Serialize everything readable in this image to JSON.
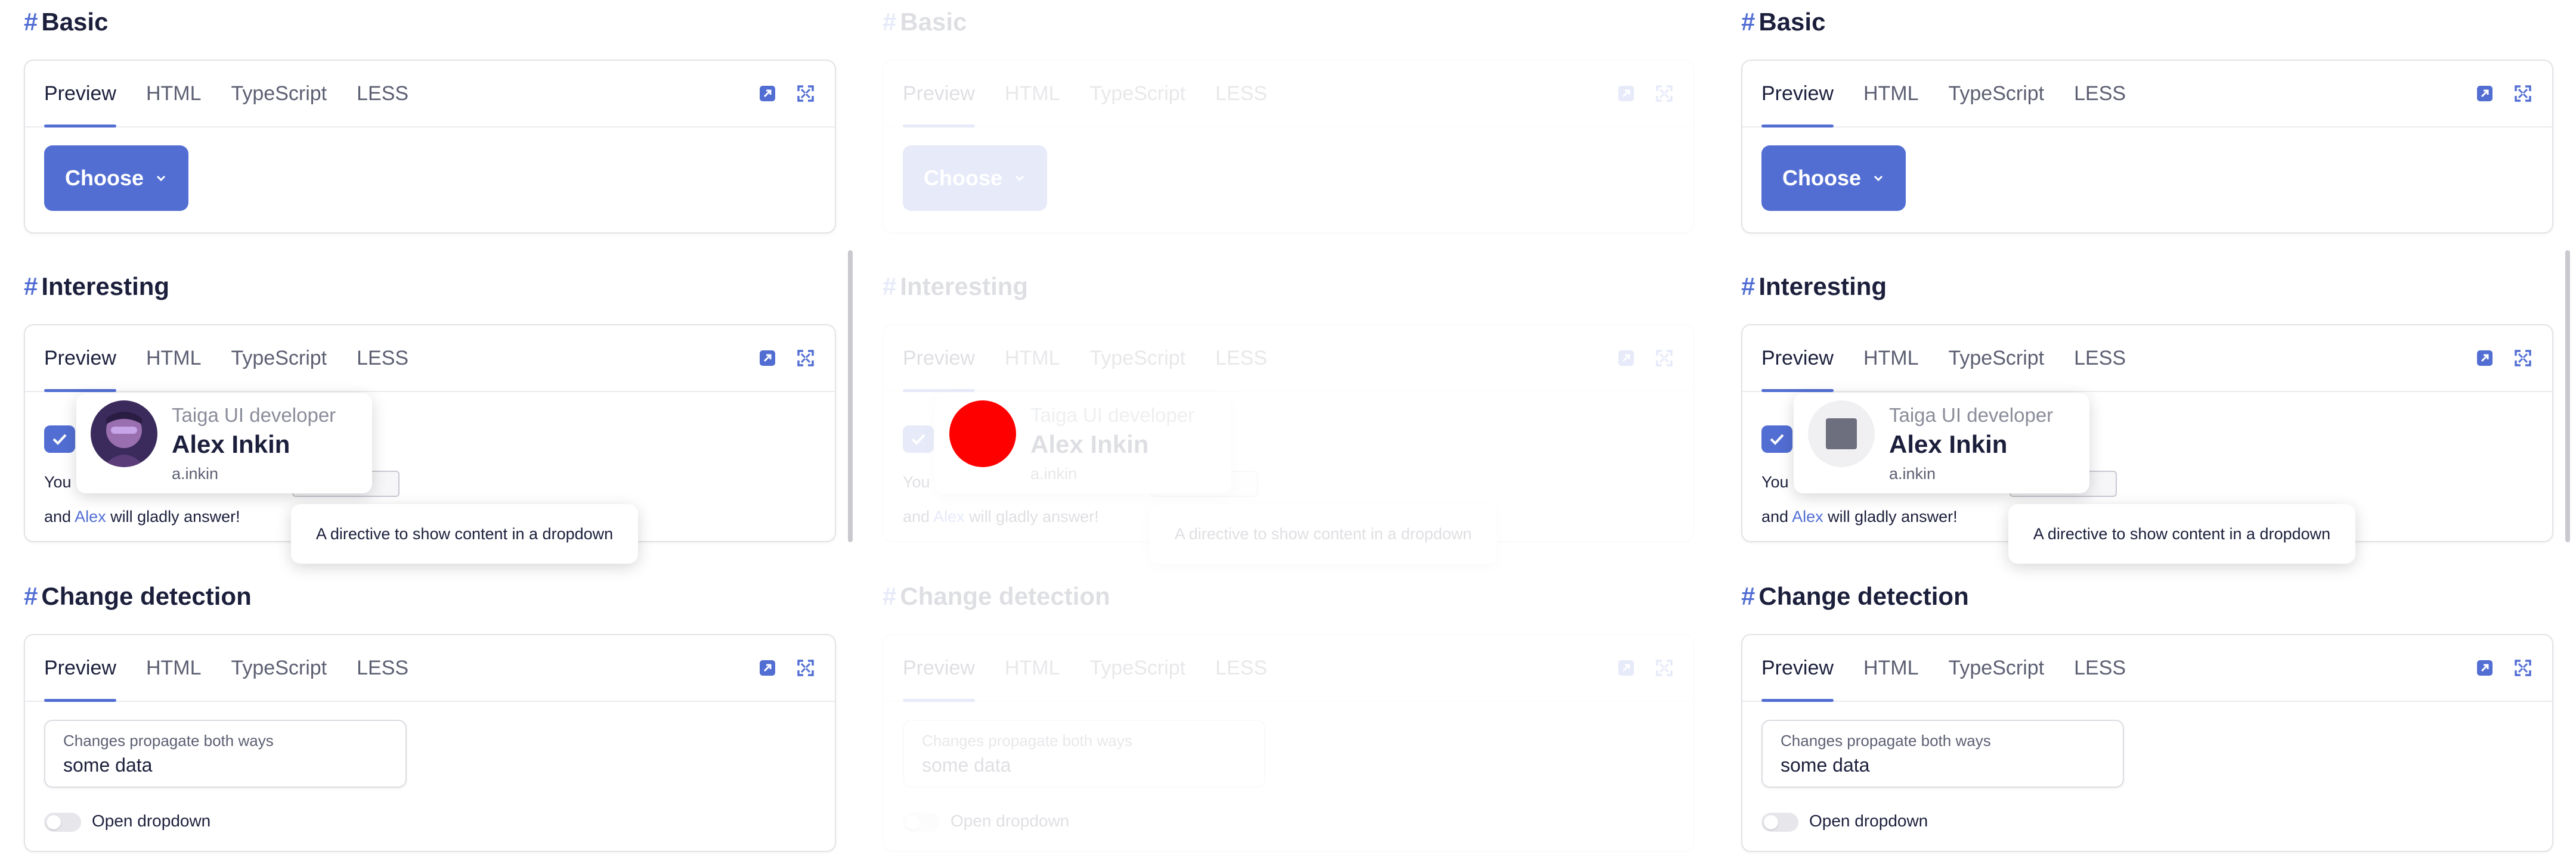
{
  "sections": {
    "basic": "Basic",
    "interesting": "Interesting",
    "change_detection": "Change detection",
    "hash": "#"
  },
  "tabs": [
    "Preview",
    "HTML",
    "TypeScript",
    "LESS"
  ],
  "choose_label": "Choose",
  "profile": {
    "role": "Taiga UI developer",
    "name": "Alex Inkin",
    "handle": "a.inkin"
  },
  "interesting_text": {
    "line1_prefix": "You c",
    "line2_prefix": "and ",
    "line2_link": "Alex",
    "line2_suffix": " will gladly answer!",
    "hint": "A directive to show content in a dropdown"
  },
  "change": {
    "field_label": "Changes propagate both ways",
    "field_value": "some data",
    "toggle_label": "Open dropdown",
    "toggle_on": false
  },
  "colors": {
    "accent": "#526ed3",
    "text": "#1b1f3b",
    "muted": "#5c5f72",
    "avatar_placeholder_red": "#ff0000",
    "avatar_placeholder_gray": "#6d6f7f"
  },
  "icons": {
    "tool1": "open-in-new-icon",
    "tool2": "fullscreen-icon",
    "choose": "chevron-down-icon",
    "checkbox": "check-icon"
  }
}
